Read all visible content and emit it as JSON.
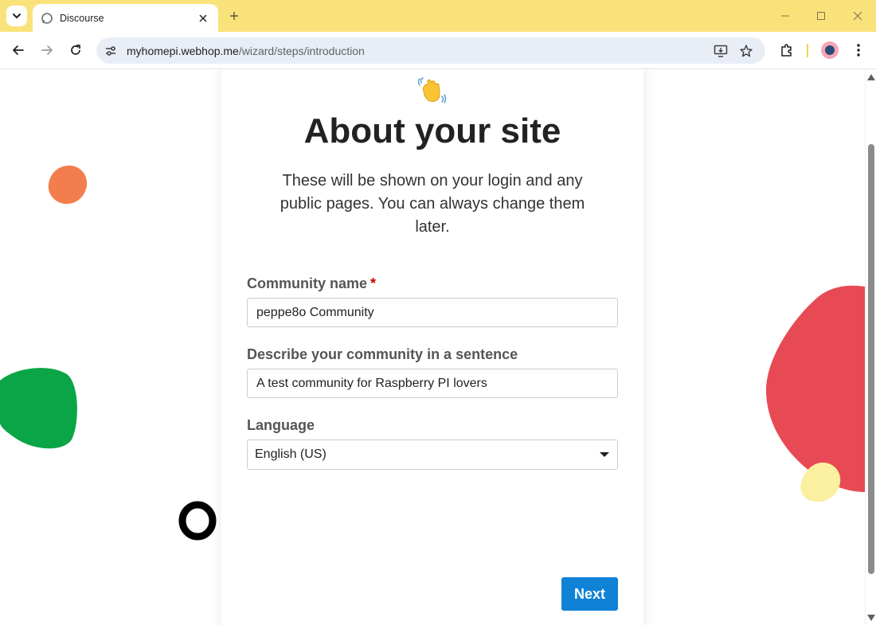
{
  "browser": {
    "tab": {
      "title": "Discourse",
      "favicon": "discourse-icon"
    },
    "address": {
      "host": "myhomepi.webhop.me",
      "path": "/wizard/steps/introduction"
    },
    "colors": {
      "frame": "#f9e27a",
      "omnibox": "#e9eef6"
    }
  },
  "wizard": {
    "emoji": "👋",
    "title": "About your site",
    "description": "These will be shown on your login and any public pages. You can always change them later.",
    "fields": {
      "community_name": {
        "label": "Community name",
        "required_mark": "*",
        "value": "peppe8o Community"
      },
      "description": {
        "label": "Describe your community in a sentence",
        "value": "A test community for Raspberry PI lovers"
      },
      "language": {
        "label": "Language",
        "selected": "English (US)"
      }
    },
    "next_label": "Next",
    "colors": {
      "accent": "#0f82d6",
      "required": "#c80000",
      "heading": "#222222"
    }
  },
  "decorations": {
    "colors": {
      "orange": "#f27e4d",
      "green": "#0aa546",
      "red": "#e84a55",
      "yellow": "#fbf0a0",
      "black": "#000000"
    }
  }
}
